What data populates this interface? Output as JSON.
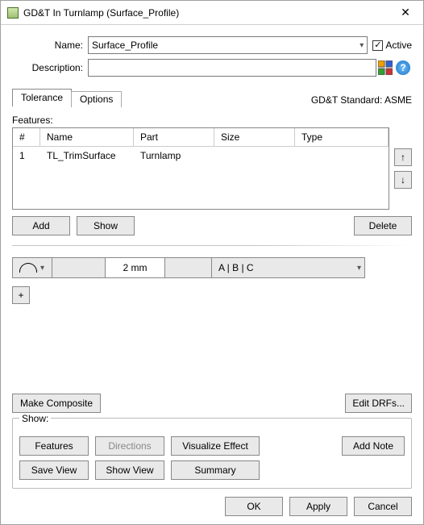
{
  "titlebar": {
    "text": "GD&T In Turnlamp (Surface_Profile)"
  },
  "form": {
    "name_label": "Name:",
    "name_value": "Surface_Profile",
    "active_label": "Active",
    "active_checked": "✓",
    "desc_label": "Description:",
    "desc_value": ""
  },
  "tabs": {
    "tolerance": "Tolerance",
    "options": "Options"
  },
  "standard": {
    "text": "GD&T Standard: ASME"
  },
  "features": {
    "label": "Features:",
    "headers": {
      "n": "#",
      "name": "Name",
      "part": "Part",
      "size": "Size",
      "type": "Type"
    },
    "rows": [
      {
        "n": "1",
        "name": "TL_TrimSurface",
        "part": "Turnlamp",
        "size": "",
        "type": ""
      }
    ],
    "arrows": {
      "up": "↑",
      "down": "↓"
    },
    "buttons": {
      "add": "Add",
      "show": "Show",
      "delete": "Delete"
    }
  },
  "tol": {
    "size": "2 mm",
    "drf": "A | B | C",
    "plus": "+"
  },
  "lower_buttons": {
    "make_composite": "Make Composite",
    "edit_drfs": "Edit DRFs..."
  },
  "show": {
    "legend": "Show:",
    "features": "Features",
    "directions": "Directions",
    "visualize": "Visualize Effect",
    "add_note": "Add Note",
    "save_view": "Save View",
    "show_view": "Show View",
    "summary": "Summary"
  },
  "footer": {
    "ok": "OK",
    "apply": "Apply",
    "cancel": "Cancel"
  },
  "help": {
    "q": "?"
  }
}
